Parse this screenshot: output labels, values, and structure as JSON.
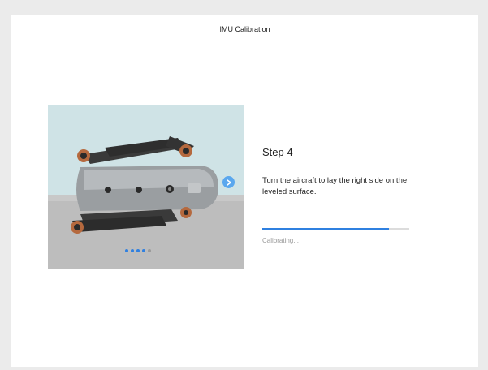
{
  "dialog": {
    "title": "IMU Calibration"
  },
  "illustration": {
    "subject": "aircraft-on-right-side",
    "next_icon": "chevron-right-icon",
    "pager": {
      "total": 5,
      "active": 4
    },
    "colors": {
      "background_wall": "#cfe3e6",
      "background_floor": "#bdbdbd",
      "accent": "#2f80e0"
    }
  },
  "step": {
    "title": "Step 4",
    "instruction": "Turn the aircraft to lay the right side on the leveled surface."
  },
  "progress": {
    "value": 0.86,
    "status": "Calibrating..."
  }
}
